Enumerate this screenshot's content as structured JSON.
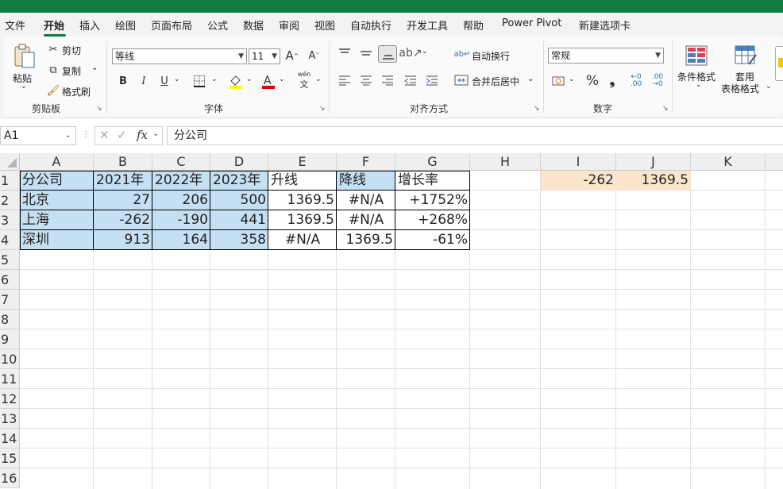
{
  "ribbon_tabs": [
    "文件",
    "开始",
    "插入",
    "绘图",
    "页面布局",
    "公式",
    "数据",
    "审阅",
    "视图",
    "自动执行",
    "开发工具",
    "帮助",
    "Power Pivot",
    "新建选项卡"
  ],
  "active_tab": "开始",
  "clipboard": {
    "paste": "粘贴",
    "cut": "剪切",
    "copy": "复制",
    "format_painter": "格式刷",
    "group": "剪贴板"
  },
  "font": {
    "family": "等线",
    "size": "11",
    "bold": "B",
    "italic": "I",
    "underline": "U",
    "phonetic": "wén",
    "group": "字体"
  },
  "alignment": {
    "wrap_text": "自动换行",
    "merge_center": "合并后居中",
    "group": "对齐方式"
  },
  "number": {
    "format": "常规",
    "percent": "%",
    "comma": "❟",
    "group": "数字"
  },
  "styles": {
    "conditional": "条件格式",
    "table_format_1": "套用",
    "table_format_2": "表格格式"
  },
  "formula_bar": {
    "name_box": "A1",
    "fx": "fx",
    "content": "分公司"
  },
  "columns": [
    "A",
    "B",
    "C",
    "D",
    "E",
    "F",
    "G",
    "H",
    "I",
    "J",
    "K"
  ],
  "rows": [
    "1",
    "2",
    "3",
    "4",
    "5",
    "6",
    "7",
    "8",
    "9",
    "10",
    "11",
    "12",
    "13",
    "14",
    "15",
    "16"
  ],
  "table": {
    "headers": [
      "分公司",
      "2021年",
      "2022年",
      "2023年",
      "升线",
      "降线",
      "增长率"
    ],
    "rows": [
      [
        "北京",
        "27",
        "206",
        "500",
        "1369.5",
        "#N/A",
        "+1752%"
      ],
      [
        "上海",
        "-262",
        "-190",
        "441",
        "1369.5",
        "#N/A",
        "+268%"
      ],
      [
        "深圳",
        "913",
        "164",
        "358",
        "#N/A",
        "1369.5",
        "-61%"
      ]
    ]
  },
  "side_values": {
    "i1": "-262",
    "j1": "1369.5"
  },
  "colors": {
    "excel_green": "#107c41",
    "header_fill": "#c5dff3",
    "side_fill": "#fbe5cd"
  }
}
